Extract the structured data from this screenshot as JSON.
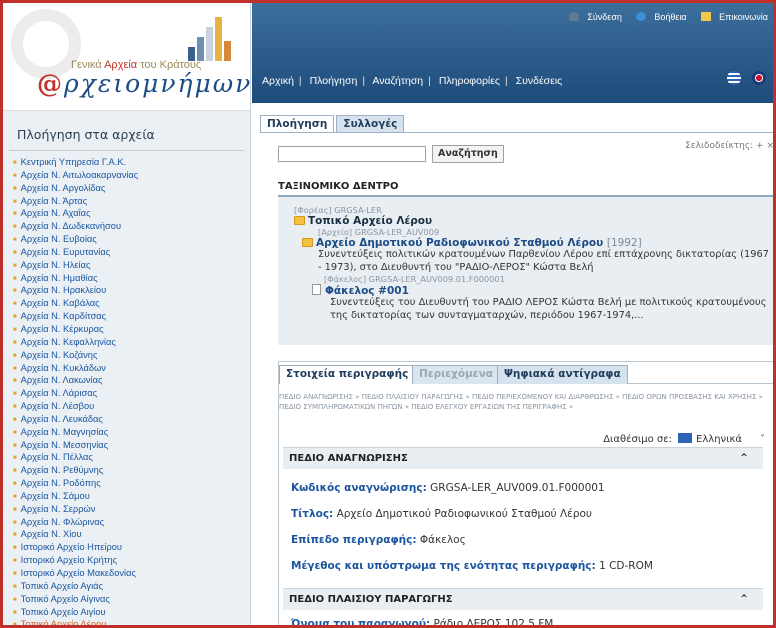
{
  "logo": {
    "subtitle_prefix": "Γενικά ",
    "subtitle_highlight": "Αρχεία",
    "subtitle_suffix": " του Κράτους",
    "at_symbol": "@",
    "main_text": "ρχειομνήμων",
    "bar_colors": [
      "#3a5f8a",
      "#6f8fb0",
      "#c7d3df",
      "#e6b347",
      "#d8883a"
    ]
  },
  "sidebar": {
    "title": "Πλοήγηση στα αρχεία",
    "items": [
      "Κεντρική Υπηρεσία Γ.Α.Κ.",
      "Αρχεία Ν. Αιτωλοακαρνανίας",
      "Αρχεία Ν. Αργολίδας",
      "Αρχεία Ν. Άρτας",
      "Αρχεία Ν. Αχαΐας",
      "Αρχεία Ν. Δωδεκανήσου",
      "Αρχεία Ν. Ευβοίας",
      "Αρχεία Ν. Ευρυτανίας",
      "Αρχεία Ν. Ηλείας",
      "Αρχεία Ν. Ημαθίας",
      "Αρχεία Ν. Ηρακλείου",
      "Αρχεία Ν. Καβάλας",
      "Αρχεία Ν. Καρδίτσας",
      "Αρχεία Ν. Κέρκυρας",
      "Αρχεία Ν. Κεφαλληνίας",
      "Αρχεία Ν. Κοζάνης",
      "Αρχεία Ν. Κυκλάδων",
      "Αρχεία Ν. Λακωνίας",
      "Αρχεία Ν. Λάρισας",
      "Αρχεία Ν. Λέσβου",
      "Αρχεία Ν. Λευκάδας",
      "Αρχεία Ν. Μαγνησίας",
      "Αρχεία Ν. Μεσσηνίας",
      "Αρχεία Ν. Πέλλας",
      "Αρχεία Ν. Ρεθύμνης",
      "Αρχεία Ν. Ροδόπης",
      "Αρχεία Ν. Σάμου",
      "Αρχεία Ν. Σερρών",
      "Αρχεία Ν. Φλώρινας",
      "Αρχεία Ν. Χίου",
      "Ιστορικό Αρχείο Ηπείρου",
      "Ιστορικό Αρχείο Κρήτης",
      "Ιστορικό Αρχείο Μακεδονίας",
      "Τοπικό Αρχείο Αγιάς",
      "Τοπικό Αρχείο Αίγινας",
      "Τοπικό Αρχείο Αιγίου",
      "Τοπικό Αρχείο Λέρου"
    ],
    "active_index": 36
  },
  "header": {
    "login": "Σύνδεση",
    "help": "Βοήθεια",
    "contact": "Επικοινωνία",
    "nav": [
      "Αρχική",
      "Πλοήγηση",
      "Αναζήτηση",
      "Πληροφορίες",
      "Συνδέσεις"
    ],
    "nav_sep": "|"
  },
  "main": {
    "tabs": [
      "Πλοήγηση",
      "Συλλογές"
    ],
    "bookmark": "Σελιδοδείκτης: + ×",
    "search_button": "Αναζήτηση",
    "search_value": "",
    "tree_title": "ΤΑΞΙΝΟΜΙΚΟ ΔΕΝΤΡΟ",
    "tree": {
      "n1_meta": "[Φορέας] GRGSA-LER",
      "n1_title": "Τοπικό Αρχείο Λέρου",
      "n2_meta": "[Αρχείο] GRGSA-LER_AUV009",
      "n2_title": "Αρχείο Δημοτικού Ραδιοφωνικού Σταθμού Λέρου",
      "n2_year": "[1992]",
      "n2_desc": "Συνεντεύξεις πολιτικών κρατουμένων Παρθενίου Λέρου επί επτάχρονης δικτατορίας (1967 - 1973), στο Διευθυντή του \"ΡΑΔΙΟ-ΛΕΡΟΣ\" Κώστα Βελή",
      "n3_meta": "[Φάκελος] GRGSA-LER_AUV009.01.F000001",
      "n3_title": "Φάκελος #001",
      "n3_desc": "Συνεντεύξεις του Διευθυντή του ΡΑΔΙΟ ΛΕΡΟΣ Κώστα Βελή με πολιτικούς κρατουμένους της δικτατορίας των συνταγματαρχών, περιόδου 1967-1974,..."
    }
  },
  "description": {
    "tabs": [
      "Στοιχεία περιγραφής",
      "Περιεχόμενα",
      "Ψηφιακά αντίγραφα"
    ],
    "crumbs": "ΠΕΔΙΟ ΑΝΑΓΝΩΡΙΣΗΣ » ΠΕΔΙΟ ΠΛΑΙΣΙΟΥ ΠΑΡΑΓΩΓΗΣ » ΠΕΔΙΟ ΠΕΡΙΕΧΟΜΕΝΟΥ ΚΑΙ ΔΙΑΡΘΡΩΣΗΣ » ΠΕΔΙΟ ΟΡΩΝ ΠΡΟΣΒΑΣΗΣ ΚΑΙ ΧΡΗΣΗΣ » ΠΕΔΙΟ ΣΥΜΠΛΗΡΩΜΑΤΙΚΩΝ ΠΗΓΩΝ » ΠΕΔΙΟ ΕΛΕΓΧΟΥ ΕΡΓΑΣΙΩΝ ΤΗΣ ΠΕΡΙΓΡΑΦΗΣ »",
    "available_label": "Διαθέσιμο σε:",
    "language": "Ελληνικά",
    "section1": "ΠΕΔΙΟ ΑΝΑΓΝΩΡΙΣΗΣ",
    "f1_label": "Κωδικός αναγνώρισης:",
    "f1_value": " GRGSA-LER_AUV009.01.F000001",
    "f2_label": "Τίτλος:",
    "f2_value": " Αρχείο Δημοτικού Ραδιοφωνικού Σταθμού Λέρου",
    "f3_label": "Επίπεδο περιγραφής:",
    "f3_value": " Φάκελος",
    "f4_label": "Μέγεθος και υπόστρωμα της ενότητας περιγραφής:",
    "f4_value": " 1 CD-ROM",
    "section2": "ΠΕΔΙΟ ΠΛΑΙΣΙΟΥ ΠΑΡΑΓΩΓΗΣ",
    "f5_label": "Όνομα του παραγωγού:",
    "f5_value": " Ράδιο ΛΕΡΟΣ 102,5 FM"
  }
}
